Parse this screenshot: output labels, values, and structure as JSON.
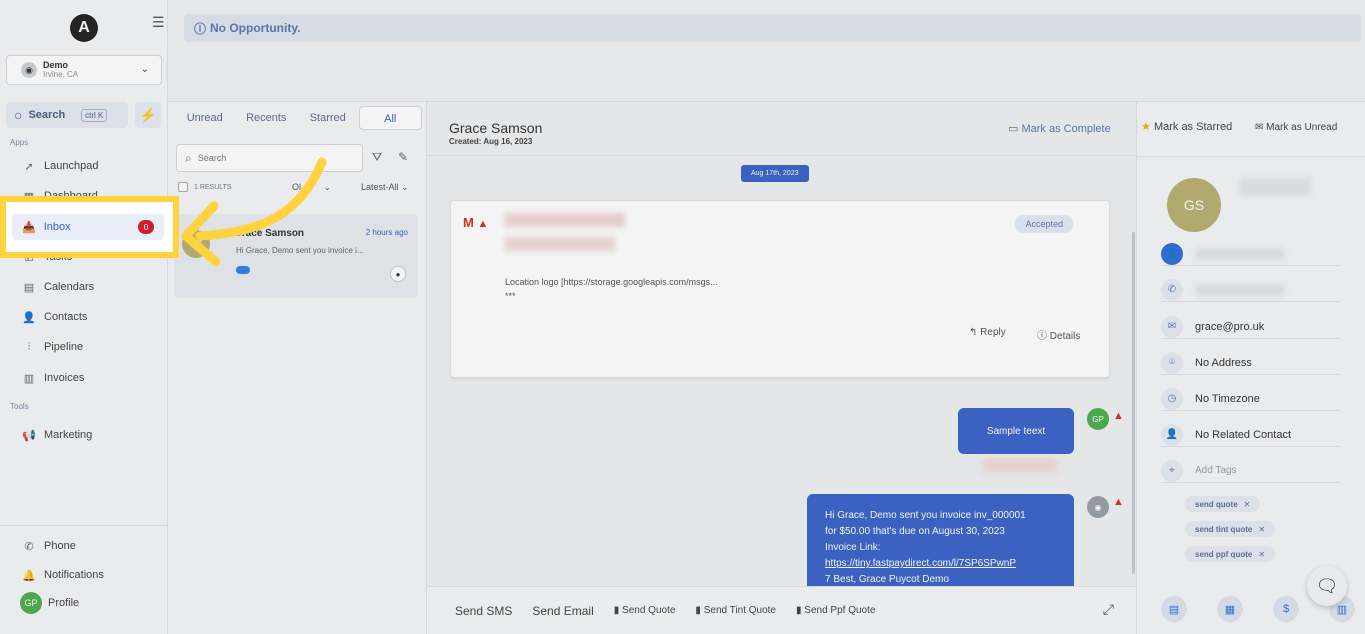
{
  "sidebar": {
    "logo": "A",
    "account": {
      "name": "Demo",
      "location": "Irvine, CA"
    },
    "search": {
      "label": "Search",
      "shortcut": "ctrl K"
    },
    "apps_heading": "Apps",
    "tools_heading": "Tools",
    "items": {
      "launchpad": "Launchpad",
      "dashboard": "Dashboard",
      "inbox": "Inbox",
      "inbox_badge": "0",
      "tasks": "Tasks",
      "calendars": "Calendars",
      "contacts": "Contacts",
      "pipeline": "Pipeline",
      "invoices": "Invoices",
      "marketing": "Marketing"
    },
    "bottom": {
      "phone": "Phone",
      "notifications": "Notifications",
      "profile": "Profile",
      "profile_initials": "GP"
    }
  },
  "banner": {
    "text": "No Opportunity."
  },
  "conversations": {
    "tabs": [
      "Unread",
      "Recents",
      "Starred",
      "All"
    ],
    "active_tab": "All",
    "search_placeholder": "Search",
    "results": "1 RESULTS",
    "sort_left": "Ol",
    "sort_right": "Latest-All",
    "item": {
      "initials": "GS",
      "name": "Grace Samson",
      "time": "2 hours ago",
      "preview": "Hi Grace, Demo sent you invoice i..."
    }
  },
  "chat": {
    "contact_name": "Grace Samson",
    "created": "Created: Aug 16, 2023",
    "mark_complete": "Mark as Complete",
    "date_divider": "Aug 17th, 2023",
    "email": {
      "status": "Accepted",
      "body_line1": "Location logo [https://storage.googleapis.com/msgs...",
      "body_line2": "***",
      "reply": "Reply",
      "details": "Details"
    },
    "msg1": {
      "text": "Sample teext",
      "sender": "GP"
    },
    "msg2": {
      "line1": "Hi Grace, Demo sent you invoice inv_000001",
      "line2": "for $50.00 that's due on August 30, 2023",
      "line3": "Invoice Link:",
      "link": "https://tiny.fastpaydirect.com/l/7SP6SPwnP",
      "line4": "7 Best, Grace Puycot Demo"
    },
    "composer": {
      "sms": "Send SMS",
      "email": "Send Email",
      "quote": "Send Quote",
      "tint": "Send Tint Quote",
      "ppf": "Send Ppf Quote"
    }
  },
  "contact_panel": {
    "mark_starred": "Mark as Starred",
    "mark_unread": "Mark as Unread",
    "initials": "GS",
    "email": "grace@pro.uk",
    "address": "No Address",
    "timezone": "No Timezone",
    "related": "No Related Contact",
    "tags_placeholder": "Add Tags",
    "tags": [
      "send quote",
      "send tint quote",
      "send ppf quote"
    ]
  },
  "colors": {
    "accent": "#3b64c9",
    "highlight": "#ffd23f",
    "alert": "#d93025"
  }
}
